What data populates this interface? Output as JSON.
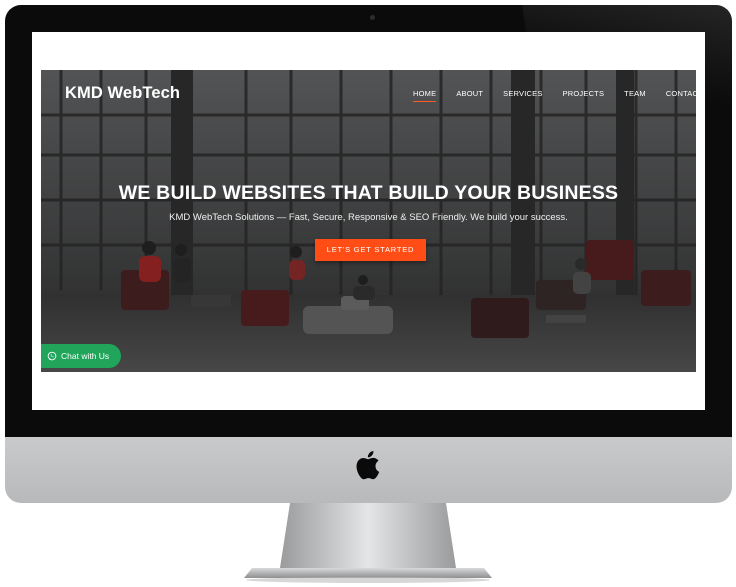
{
  "site": {
    "brand": "KMD WebTech",
    "nav": [
      {
        "label": "HOME",
        "active": true
      },
      {
        "label": "ABOUT",
        "active": false
      },
      {
        "label": "SERVICES",
        "active": false
      },
      {
        "label": "PROJECTS",
        "active": false
      },
      {
        "label": "TEAM",
        "active": false
      },
      {
        "label": "CONTACT",
        "active": false
      }
    ],
    "hero": {
      "title": "WE BUILD WEBSITES THAT BUILD YOUR BUSINESS",
      "subtitle": "KMD WebTech Solutions — Fast, Secure, Responsive & SEO Friendly. We build your success.",
      "cta_label": "LET'S GET STARTED"
    },
    "chat_label": "Chat with Us"
  },
  "colors": {
    "accent": "#ff4d15",
    "chat": "#20a55b",
    "bezel": "#0b0b0c",
    "chin": "#c2c3c5"
  },
  "icons": {
    "device_logo": "apple-logo-icon",
    "chat": "whatsapp-icon"
  }
}
